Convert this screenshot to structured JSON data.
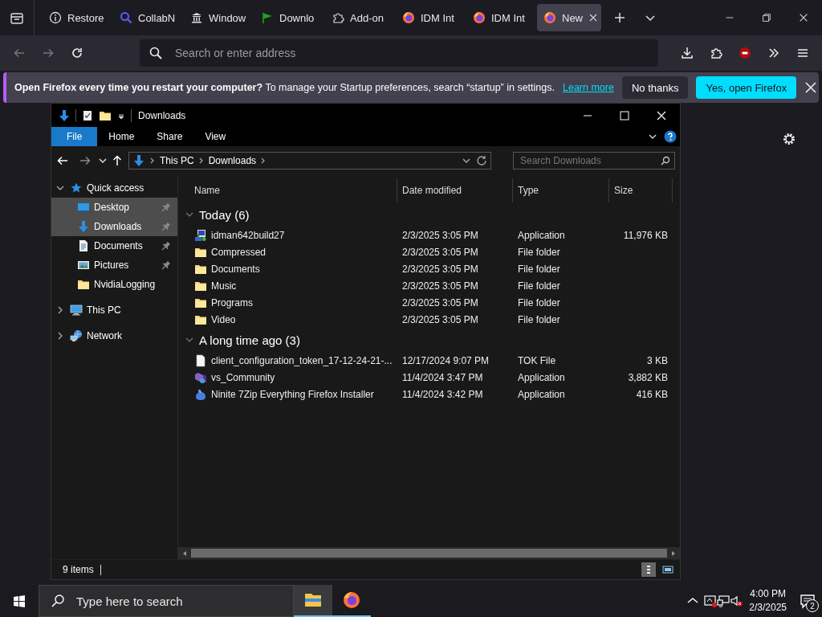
{
  "browser": {
    "tabs": [
      {
        "label": "Restore",
        "kind": "info",
        "selected": false
      },
      {
        "label": "CollabN",
        "kind": "search",
        "selected": false
      },
      {
        "label": "Window",
        "kind": "building",
        "selected": false
      },
      {
        "label": "Downlo",
        "kind": "flag",
        "selected": false
      },
      {
        "label": "Add-on",
        "kind": "puzzle",
        "selected": false
      },
      {
        "label": "IDM Int",
        "kind": "firefox",
        "selected": false
      },
      {
        "label": "IDM Int",
        "kind": "firefox",
        "selected": false
      },
      {
        "label": "New",
        "kind": "firefox",
        "selected": true
      }
    ],
    "address_placeholder": "Search or enter address",
    "notification": {
      "headline": "Open Firefox every time you restart your computer?",
      "text": "To manage your Startup preferences, search “startup” in settings.",
      "link": "Learn more",
      "buttons": [
        {
          "label": "No thanks",
          "kind": "secondary"
        },
        {
          "label": "Yes, open Firefox",
          "kind": "primary"
        }
      ]
    }
  },
  "explorer": {
    "title": "Downloads",
    "ribbon_tabs": [
      {
        "label": "File",
        "selected": true
      },
      {
        "label": "Home",
        "selected": false
      },
      {
        "label": "Share",
        "selected": false
      },
      {
        "label": "View",
        "selected": false
      }
    ],
    "breadcrumb": [
      "This PC",
      "Downloads"
    ],
    "search_placeholder": "Search Downloads",
    "columns": [
      "Name",
      "Date modified",
      "Type",
      "Size"
    ],
    "nav": [
      {
        "label": "Quick access",
        "kind": "star",
        "expanded": true,
        "children": [
          {
            "label": "Desktop",
            "kind": "desktop",
            "pinned": true,
            "selected": true
          },
          {
            "label": "Downloads",
            "kind": "download",
            "pinned": true,
            "selected": true
          },
          {
            "label": "Documents",
            "kind": "document",
            "pinned": true,
            "selected": false
          },
          {
            "label": "Pictures",
            "kind": "picture",
            "pinned": true,
            "selected": false
          },
          {
            "label": "NvidiaLogging",
            "kind": "folder",
            "pinned": false,
            "selected": false
          }
        ]
      },
      {
        "label": "This PC",
        "kind": "monitor",
        "expanded": false
      },
      {
        "label": "Network",
        "kind": "network",
        "expanded": false
      }
    ],
    "groups": [
      {
        "title": "Today (6)",
        "expanded": true,
        "rows": [
          {
            "name": "idman642build27",
            "date": "2/3/2025 3:05 PM",
            "type": "Application",
            "size": "11,976 KB",
            "kind": "installer"
          },
          {
            "name": "Compressed",
            "date": "2/3/2025 3:05 PM",
            "type": "File folder",
            "kind": "folder"
          },
          {
            "name": "Documents",
            "date": "2/3/2025 3:05 PM",
            "type": "File folder",
            "kind": "folder"
          },
          {
            "name": "Music",
            "date": "2/3/2025 3:05 PM",
            "type": "File folder",
            "kind": "folder"
          },
          {
            "name": "Programs",
            "date": "2/3/2025 3:05 PM",
            "type": "File folder",
            "kind": "folder"
          },
          {
            "name": "Video",
            "date": "2/3/2025 3:05 PM",
            "type": "File folder",
            "kind": "folder"
          }
        ]
      },
      {
        "title": "A long time ago (3)",
        "expanded": true,
        "rows": [
          {
            "name": "client_configuration_token_17-12-24-21-...",
            "date": "12/17/2024 9:07 PM",
            "type": "TOK File",
            "size": "3 KB",
            "kind": "file"
          },
          {
            "name": "vs_Community",
            "date": "11/4/2024 3:47 PM",
            "type": "Application",
            "size": "3,882 KB",
            "kind": "vs"
          },
          {
            "name": "Ninite 7Zip Everything Firefox Installer",
            "date": "11/4/2024 3:42 PM",
            "type": "Application",
            "size": "416 KB",
            "kind": "ninite"
          }
        ]
      }
    ],
    "status": "9 items"
  },
  "taskbar": {
    "search_placeholder": "Type here to search",
    "time": "4:00 PM",
    "date": "2/3/2025",
    "notification_count": "2"
  }
}
